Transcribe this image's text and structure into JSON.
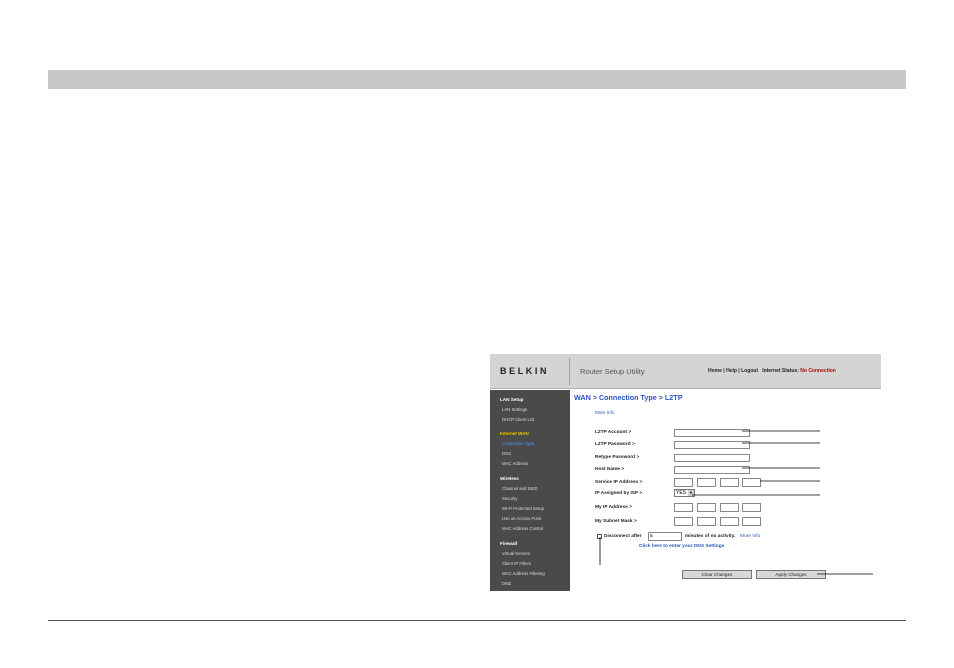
{
  "header": {
    "logo": "BELKIN",
    "title": "Router Setup Utility",
    "links": "Home | Help | Logout",
    "status_label": "Internet Status:",
    "status_value": "No Connection"
  },
  "sidebar": {
    "sections": [
      {
        "heading": "LAN Setup",
        "items": [
          "LAN Settings",
          "DHCP Client List"
        ]
      },
      {
        "heading": "Internet WAN",
        "items": [
          "Connection Type",
          "DNS",
          "MAC Address"
        ]
      },
      {
        "heading": "Wireless",
        "items": [
          "Channel and SSID",
          "Security",
          "Wi-Fi Protected Setup",
          "Use as Access Point",
          "MAC Address Control"
        ]
      },
      {
        "heading": "Firewall",
        "items": [
          "Virtual Servers",
          "Client IP Filters",
          "MAC Address Filtering",
          "DMZ"
        ]
      }
    ]
  },
  "main": {
    "title": "WAN > Connection Type > L2TP",
    "more_info": "More Info",
    "fields": {
      "account": "L2TP Account >",
      "password": "L2TP Password >",
      "retype": "Retype Password >",
      "host": "Host Name >",
      "service_ip": "Service IP Address >",
      "ip_assigned": "IP Assigned by ISP >",
      "my_ip": "My IP Address >",
      "subnet": "My Subnet Mask >"
    },
    "ip_assigned_value": "YES",
    "disconnect_label": "Disconnect after",
    "disconnect_minutes": "5",
    "minutes_label": "minutes of no activity.",
    "more_info_2": "More Info",
    "dns_link": "Click here to enter your DNS Settings",
    "clear_button": "Clear Changes",
    "apply_button": "Apply Changes"
  },
  "colors": {
    "accent": "#2b55c0",
    "status": "#b00000",
    "sidebar_bg": "#4a4a4a",
    "active_section": "#f0c400"
  }
}
